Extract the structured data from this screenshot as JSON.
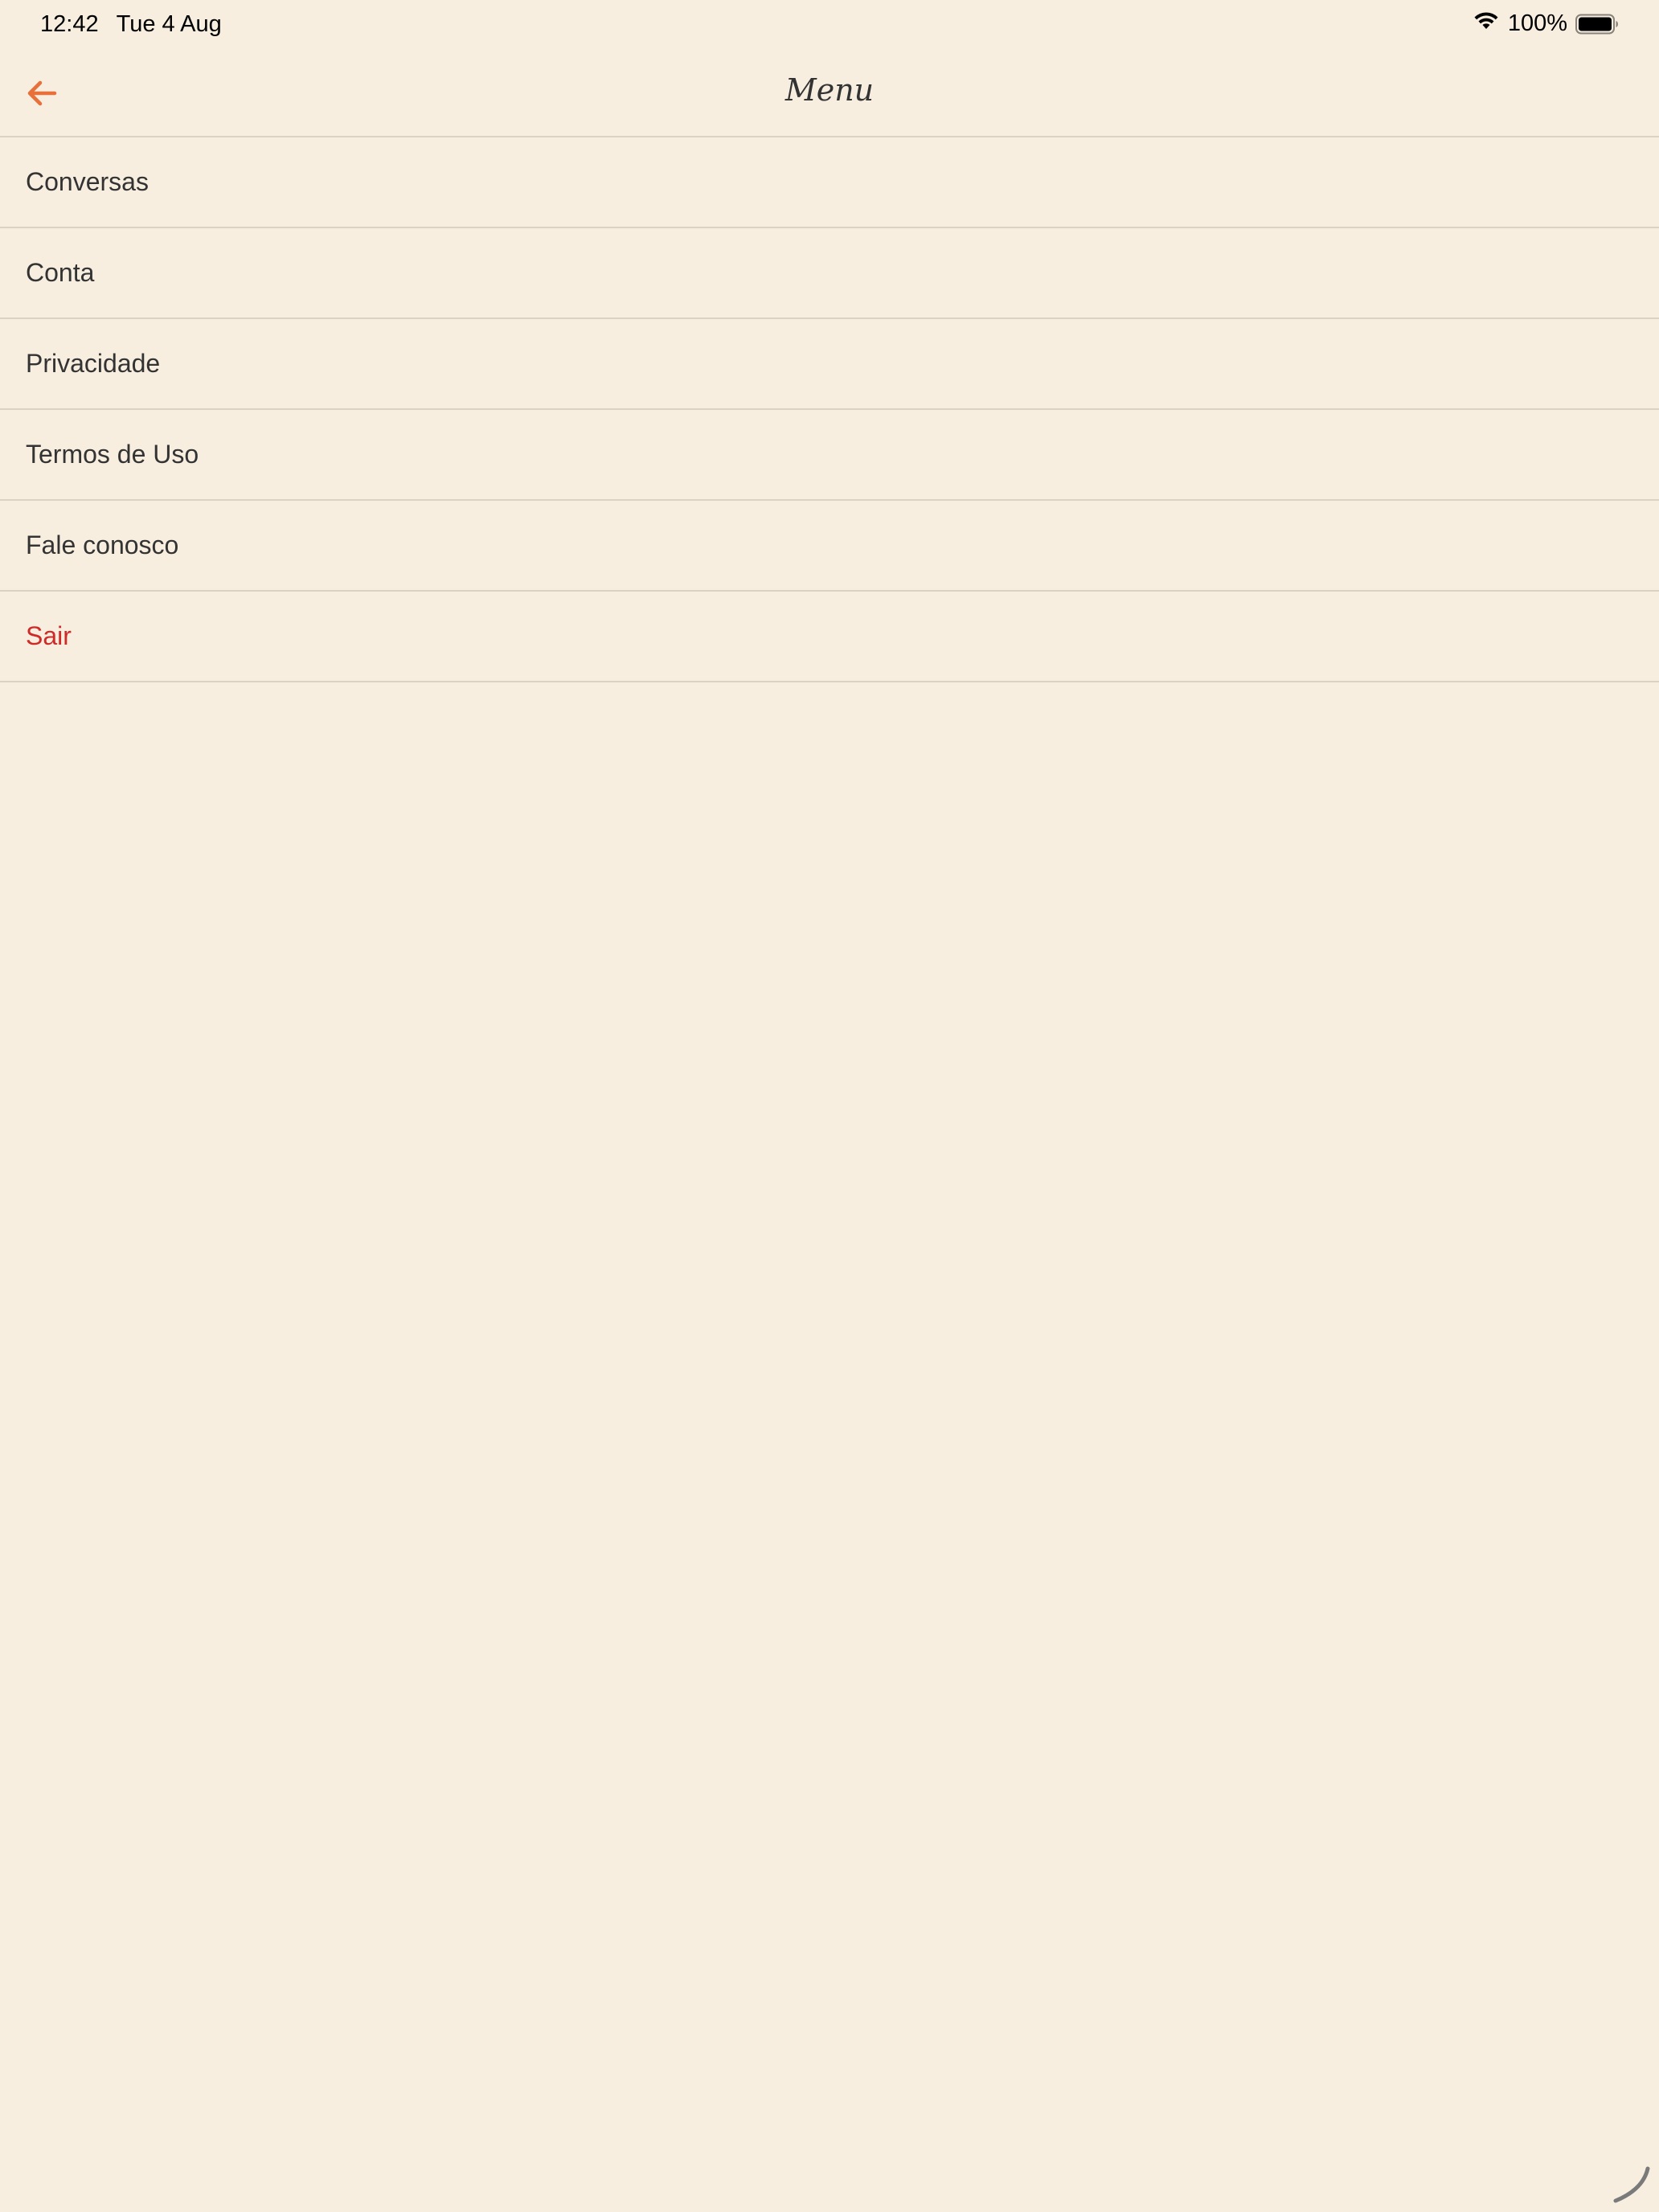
{
  "status_bar": {
    "time": "12:42",
    "date": "Tue 4 Aug",
    "battery_percent": "100%",
    "battery_level": 1.0
  },
  "nav": {
    "title": "Menu",
    "back_icon": "arrow-left-icon"
  },
  "menu": {
    "items": [
      {
        "label": "Conversas"
      },
      {
        "label": "Conta"
      },
      {
        "label": "Privacidade"
      },
      {
        "label": "Termos de Uso"
      },
      {
        "label": "Fale conosco"
      },
      {
        "label": "Sair"
      }
    ]
  },
  "colors": {
    "background": "#f7eedf",
    "accent": "#e8703a",
    "danger": "#cf2a27",
    "text": "#333333",
    "divider": "#d9d2c5"
  }
}
